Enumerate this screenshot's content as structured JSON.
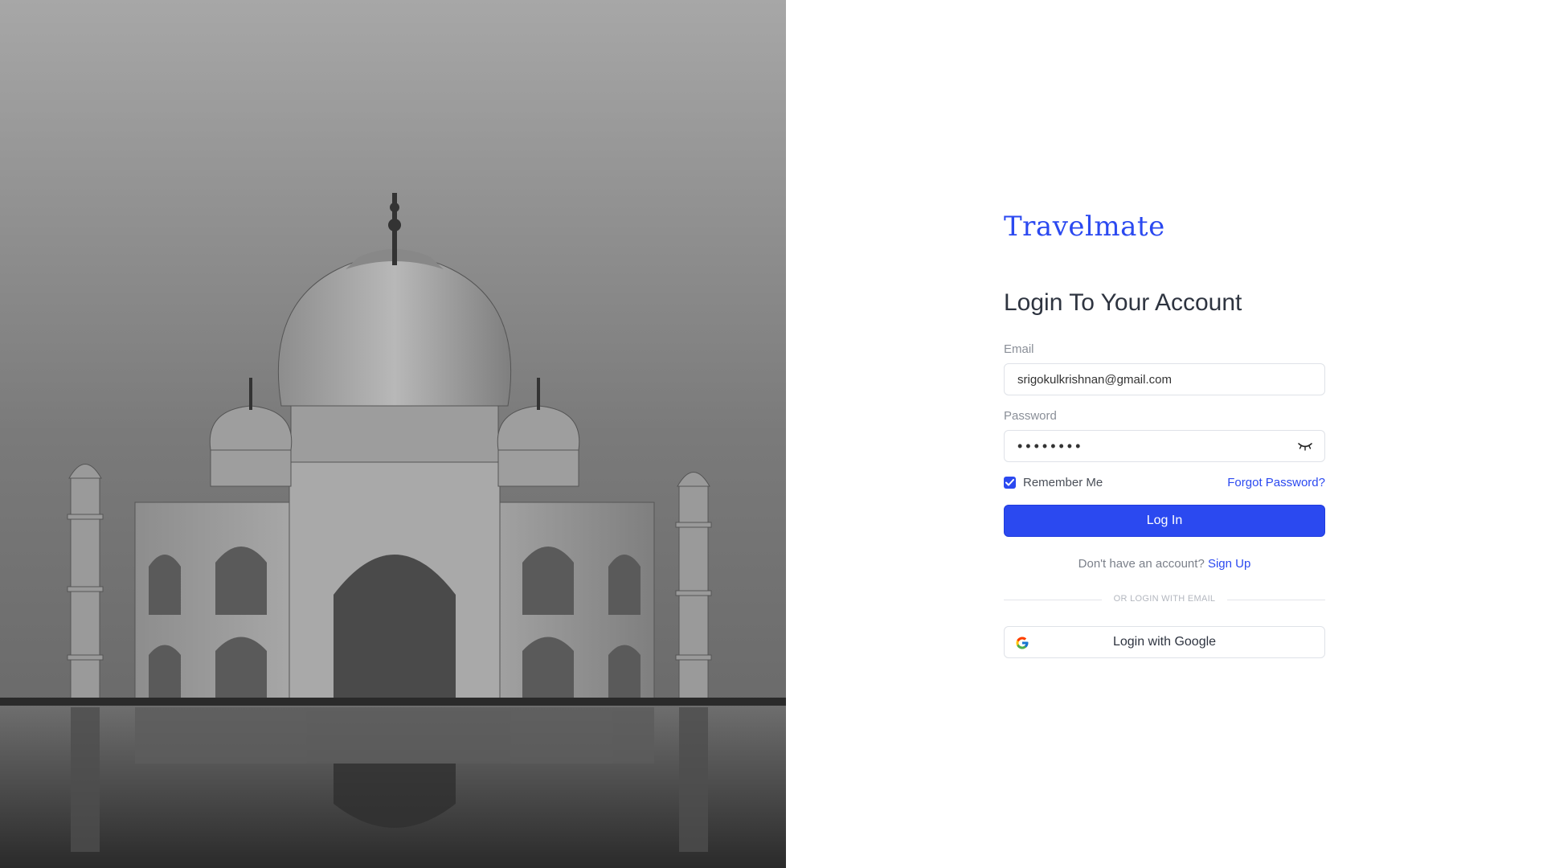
{
  "brand": {
    "name": "Travelmate"
  },
  "login": {
    "heading": "Login To Your Account",
    "email_label": "Email",
    "email_value": "srigokulkrishnan@gmail.com",
    "password_label": "Password",
    "password_value": "12345678",
    "password_toggle_icon": "eye-closed-icon",
    "remember_label": "Remember Me",
    "remember_checked": true,
    "forgot_label": "Forgot Password?",
    "login_button": "Log In",
    "no_account_text": "Don't have an account?",
    "signup_label": "Sign Up",
    "divider_text": "OR LOGIN WITH EMAIL",
    "google_button": "Login with Google"
  },
  "colors": {
    "accent": "#2b49f0",
    "heading": "#2e3440",
    "muted": "#8a8f98"
  },
  "hero": {
    "icon": "taj-mahal-photo"
  }
}
